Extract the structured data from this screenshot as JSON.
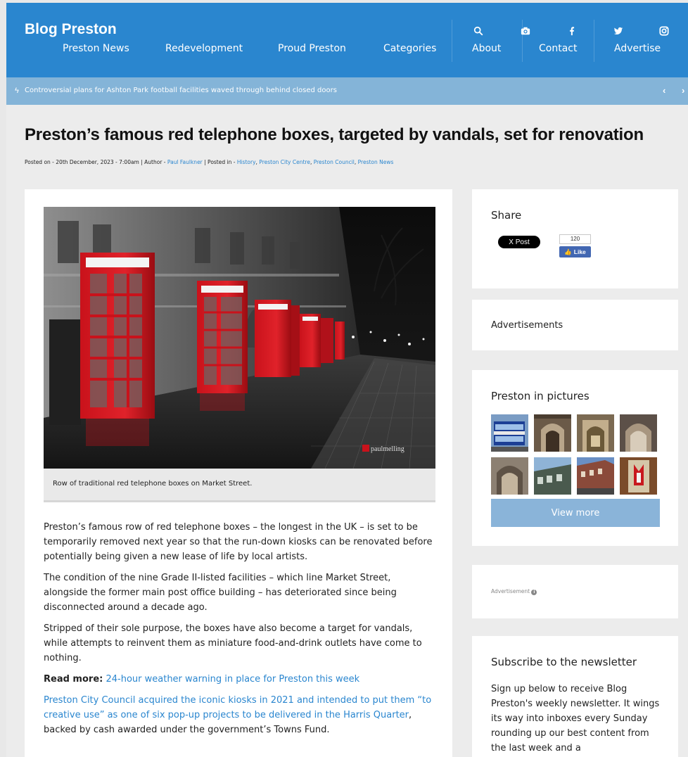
{
  "header": {
    "logo": "Blog Preston",
    "nav": [
      "Preston News",
      "Redevelopment",
      "Proud Preston",
      "Categories",
      "About",
      "Contact",
      "Advertise"
    ],
    "icons": [
      "search-icon",
      "camera-icon",
      "facebook-icon",
      "twitter-icon",
      "instagram-icon"
    ],
    "bg_color": "#2a86cf"
  },
  "ticker": {
    "text": "Controversial plans for Ashton Park football facilities waved through behind closed doors",
    "prev": "‹",
    "next": "›"
  },
  "article": {
    "title": "Preston’s famous red telephone boxes, targeted by vandals, set for renovation",
    "meta": {
      "posted_label": "Posted on - ",
      "date": "20th December, 2023 - 7:00am",
      "author_label": " | Author - ",
      "author": "Paul Faulkner",
      "posted_in_label": " | Posted in - ",
      "categories": [
        "History",
        "Preston City Centre",
        "Preston Council",
        "Preston News"
      ],
      "sep": ", "
    },
    "photo_watermark": "paulmelling",
    "caption": "Row of traditional red telephone boxes on Market Street.",
    "paragraphs": [
      "Preston’s famous row of red telephone boxes – the longest in the UK – is set to be temporarily removed next year so that the run-down kiosks can be renovated before potentially being given a new lease of life by local artists.",
      "The condition of the nine Grade II-listed facilities – which line Market Street, alongside the former main post office building – has deteriorated since being disconnected around a decade ago.",
      "Stripped of their sole purpose, the boxes have also become a target for vandals, while attempts to reinvent them as miniature food-and-drink outlets have come to nothing."
    ],
    "read_more_label": "Read more:",
    "read_more_link": "24-hour weather warning in place for Preston this week",
    "last_para_link": "Preston City Council acquired the iconic kiosks in 2021 and intended to put them “to creative use” as one of six pop-up projects to be delivered in the Harris Quarter",
    "last_para_rest": ", backed by cash awarded under the government’s Towns Fund."
  },
  "sidebar": {
    "share": {
      "title": "Share",
      "x_post": "X Post",
      "fb_count": "120",
      "fb_like": "Like"
    },
    "ads": {
      "title": "Advertisements"
    },
    "pictures": {
      "title": "Preston in pictures",
      "view_more": "View more"
    },
    "advert": {
      "label": "Advertisement"
    },
    "newsletter": {
      "title": "Subscribe to the newsletter",
      "text": "Sign up below to receive Blog Preston's weekly newsletter. It wings its way into inboxes every Sunday rounding up our best content from the last week and a"
    }
  }
}
